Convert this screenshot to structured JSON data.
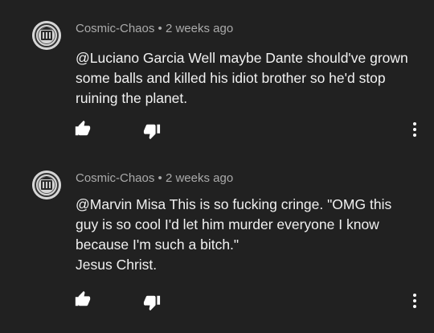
{
  "comments": [
    {
      "author": "Cosmic-Chaos",
      "separator": "•",
      "time": "2 weeks ago",
      "lines": [
        "@Luciano Garcia Well maybe Dante should've grown",
        "some balls and killed his idiot brother so he'd stop",
        "ruining the planet."
      ],
      "actions": {
        "like_icon": "thumb-up-icon",
        "dislike_icon": "thumb-down-icon",
        "more_icon": "more-vertical-icon"
      }
    },
    {
      "author": "Cosmic-Chaos",
      "separator": "•",
      "time": "2 weeks ago",
      "lines": [
        "@Marvin Misa This is so fucking cringe. \"OMG this",
        "guy is so cool I'd let him murder everyone I know",
        "because I'm such a bitch.\"",
        "Jesus Christ."
      ],
      "actions": {
        "like_icon": "thumb-up-icon",
        "dislike_icon": "thumb-down-icon",
        "more_icon": "more-vertical-icon"
      }
    }
  ],
  "colors": {
    "background": "#212121",
    "meta_text": "#aaaaaa",
    "body_text": "#f1f1f1",
    "icon": "#ffffff"
  }
}
